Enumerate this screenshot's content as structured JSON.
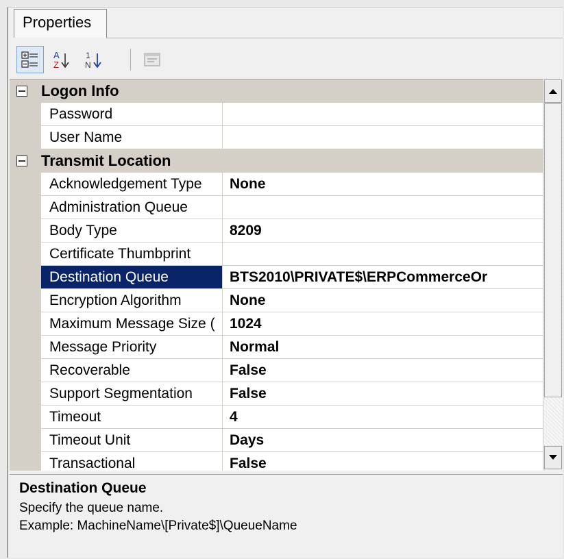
{
  "tab": {
    "label": "Properties"
  },
  "toolbar": {
    "categorized_icon": "categorized-view-icon",
    "alphabetical_icon": "sort-alphabetical-icon",
    "sort_az": {
      "top": "A",
      "bottom": "Z"
    },
    "sort_numeric": {
      "top": "1",
      "bottom": "N"
    },
    "property_pages_icon": "property-pages-icon"
  },
  "grid": {
    "categories": [
      {
        "label": "Logon Info",
        "properties": [
          {
            "name": "Password",
            "value": ""
          },
          {
            "name": "User Name",
            "value": ""
          }
        ]
      },
      {
        "label": "Transmit Location",
        "properties": [
          {
            "name": "Acknowledgement Type",
            "value": "None"
          },
          {
            "name": "Administration Queue",
            "value": ""
          },
          {
            "name": "Body Type",
            "value": "8209"
          },
          {
            "name": "Certificate Thumbprint",
            "value": ""
          },
          {
            "name": "Destination Queue",
            "value": "BTS2010\\PRIVATE$\\ERPCommerceOr",
            "selected": true
          },
          {
            "name": "Encryption Algorithm",
            "value": "None"
          },
          {
            "name": "Maximum Message Size (",
            "value": "1024"
          },
          {
            "name": "Message Priority",
            "value": "Normal"
          },
          {
            "name": "Recoverable",
            "value": "False"
          },
          {
            "name": "Support Segmentation",
            "value": "False"
          },
          {
            "name": "Timeout",
            "value": "4"
          },
          {
            "name": "Timeout Unit",
            "value": "Days"
          },
          {
            "name": "Transactional",
            "value": "False"
          }
        ]
      }
    ]
  },
  "scrollbar": {
    "position_fraction": 0.0,
    "visible_fraction": 0.86
  },
  "description": {
    "title": "Destination Queue",
    "lines": [
      "Specify the queue name.",
      "Example: MachineName\\[Private$]\\QueueName"
    ]
  },
  "colors": {
    "selection": "#0a246a",
    "category_bg": "#d4d0c8",
    "panel_bg": "#f0f0f0"
  }
}
